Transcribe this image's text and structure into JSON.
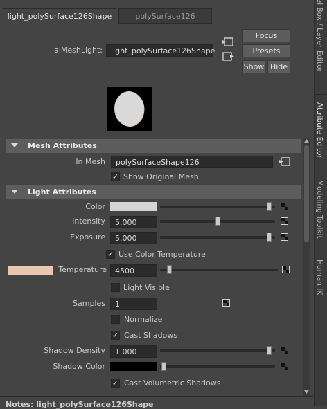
{
  "tabs": [
    "light_polySurface126Shape",
    "polySurface126"
  ],
  "node": {
    "label": "aiMeshLight:",
    "value": "light_polySurface126Shape"
  },
  "buttons": {
    "focus": "Focus",
    "presets": "Presets",
    "show": "Show",
    "hide": "Hide"
  },
  "mesh_section": {
    "title": "Mesh Attributes",
    "in_mesh_label": "In Mesh",
    "in_mesh_value": "polySurfaceShape126",
    "show_original_label": "Show Original Mesh",
    "show_original_checked": true
  },
  "light_section": {
    "title": "Light Attributes",
    "color_label": "Color",
    "color_value": "#d4d4d4",
    "color_level": 0.97,
    "intensity_label": "Intensity",
    "intensity_value": "5.000",
    "intensity_level": 0.5,
    "exposure_label": "Exposure",
    "exposure_value": "5.000",
    "exposure_level": 0.97,
    "use_color_temp_label": "Use Color Temperature",
    "use_color_temp_checked": true,
    "temperature_swatch": "#e9c7b0",
    "temperature_label": "Temperature",
    "temperature_value": "4500",
    "temperature_level": 0.06,
    "light_visible_label": "Light Visible",
    "light_visible_checked": false,
    "samples_label": "Samples",
    "samples_value": "1",
    "normalize_label": "Normalize",
    "normalize_checked": false,
    "cast_shadows_label": "Cast Shadows",
    "cast_shadows_checked": true,
    "shadow_density_label": "Shadow Density",
    "shadow_density_value": "1.000",
    "shadow_density_level": 0.97,
    "shadow_color_label": "Shadow Color",
    "shadow_color_value": "#000000",
    "cast_volumetric_label": "Cast Volumetric Shadows",
    "cast_volumetric_checked": true
  },
  "notes_label": "Notes: light_polySurface126Shape",
  "side_tabs": [
    "Channel Box / Layer Editor",
    "Attribute Editor",
    "Modeling Toolkit",
    "Human IK"
  ]
}
